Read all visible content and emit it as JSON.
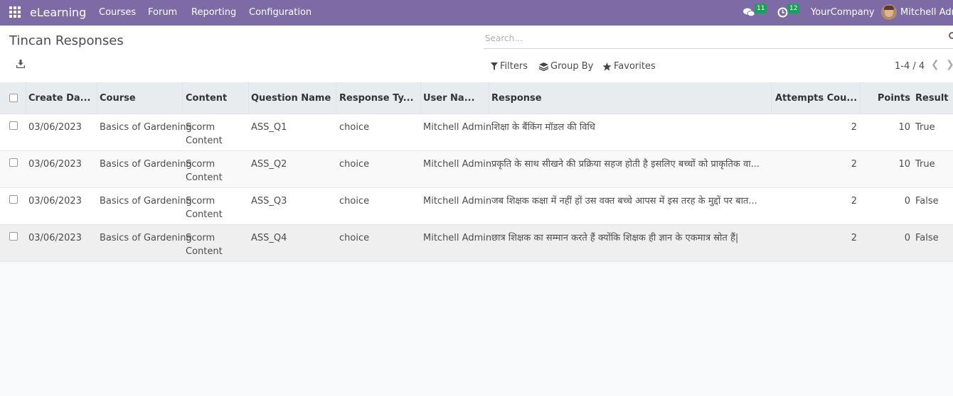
{
  "navbar": {
    "app_name": "eLearning",
    "menu": [
      "Courses",
      "Forum",
      "Reporting",
      "Configuration"
    ],
    "messages_badge": "11",
    "activities_badge": "12",
    "company": "YourCompany",
    "user": "Mitchell Admin"
  },
  "control": {
    "title": "Tincan Responses",
    "search_placeholder": "Search...",
    "filters_label": "Filters",
    "group_by_label": "Group By",
    "favorites_label": "Favorites",
    "pager": "1-4 / 4"
  },
  "table": {
    "headers": [
      "Create Da...",
      "Course",
      "Content",
      "Question Name",
      "Response Ty...",
      "User Na...",
      "Response",
      "Attempts Cou...",
      "Points",
      "Result"
    ],
    "rows": [
      {
        "date": "03/06/2023",
        "course": "Basics of Gardening",
        "content": "Scorm Content",
        "question": "ASS_Q1",
        "response_type": "choice",
        "user": "Mitchell Admin",
        "response": "शिक्षा के बैंकिंग मॉडल की विधि",
        "attempts": "2",
        "points": "10",
        "result": "True"
      },
      {
        "date": "03/06/2023",
        "course": "Basics of Gardening",
        "content": "Scorm Content",
        "question": "ASS_Q2",
        "response_type": "choice",
        "user": "Mitchell Admin",
        "response": "प्रकृति के साथ सीखने की प्रक्रिया सहज होती है इसलिए बच्चों को प्राकृतिक वा...",
        "attempts": "2",
        "points": "10",
        "result": "True"
      },
      {
        "date": "03/06/2023",
        "course": "Basics of Gardening",
        "content": "Scorm Content",
        "question": "ASS_Q3",
        "response_type": "choice",
        "user": "Mitchell Admin",
        "response": "जब शिक्षक कक्षा में नहीं हों उस वक्त बच्चे आपस में इस तरह के मुद्दों पर बात...",
        "attempts": "2",
        "points": "0",
        "result": "False"
      },
      {
        "date": "03/06/2023",
        "course": "Basics of Gardening",
        "content": "Scorm Content",
        "question": "ASS_Q4",
        "response_type": "choice",
        "user": "Mitchell Admin",
        "response": "छात्र शिक्षक का सम्मान करते हैं क्योंकि शिक्षक ही ज्ञान के एकमात्र स्रोत हैं|",
        "attempts": "2",
        "points": "0",
        "result": "False"
      }
    ]
  },
  "colors": {
    "navbar": "#7c6ba5",
    "badge": "#1aa05b"
  }
}
